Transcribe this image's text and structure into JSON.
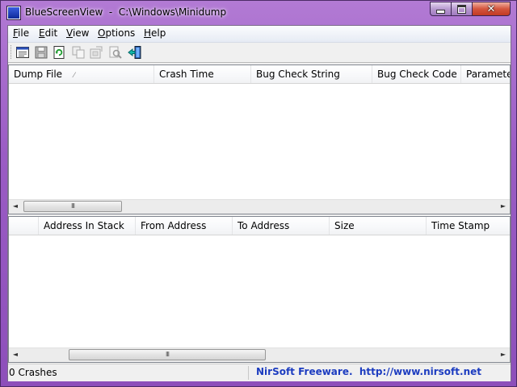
{
  "window": {
    "title": "BlueScreenView  -  C:\\Windows\\Minidump",
    "minimize_icon": "minimize-icon",
    "maximize_icon": "maximize-icon",
    "close_icon": "close-icon",
    "close_glyph": "✕"
  },
  "menu": {
    "file": {
      "accel": "F",
      "rest": "ile"
    },
    "edit": {
      "accel": "E",
      "rest": "dit"
    },
    "view": {
      "accel": "V",
      "rest": "iew"
    },
    "options": {
      "accel": "O",
      "rest": "ptions"
    },
    "help": {
      "accel": "H",
      "rest": "elp"
    }
  },
  "toolbar": {
    "buttons": [
      "properties-icon",
      "save-icon",
      "refresh-icon",
      "copy-icon",
      "report-icon",
      "find-icon",
      "exit-icon"
    ]
  },
  "upper_table": {
    "columns": [
      "Dump File",
      "Crash Time",
      "Bug Check String",
      "Bug Check Code",
      "Parameter"
    ],
    "sort_indicator": "⁄",
    "rows": []
  },
  "lower_table": {
    "columns": [
      "",
      "Address In Stack",
      "From Address",
      "To Address",
      "Size",
      "Time Stamp"
    ],
    "rows": []
  },
  "scroll": {
    "left_arrow": "◄",
    "right_arrow": "►",
    "grip": "III"
  },
  "status": {
    "count": "0 Crashes",
    "link": "NirSoft Freeware.  http://www.nirsoft.net"
  },
  "colors": {
    "link": "#1c3cc0",
    "frame": "#9a5cc4"
  }
}
